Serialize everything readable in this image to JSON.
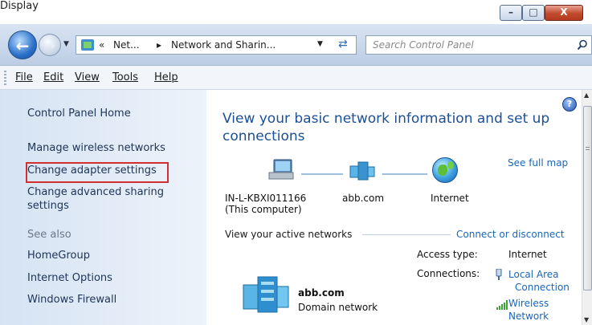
{
  "window": {
    "title": "Display",
    "minimize": "–",
    "maximize": "□",
    "close": "X"
  },
  "address": {
    "crumbs": [
      "«",
      "Net...",
      "▸",
      "Network and Sharin..."
    ],
    "search_placeholder": "Search Control Panel"
  },
  "menu": [
    "File",
    "Edit",
    "View",
    "Tools",
    "Help"
  ],
  "sidebar": {
    "home": "Control Panel Home",
    "links": [
      "Manage wireless networks",
      "Change adapter settings",
      "Change advanced sharing",
      "settings"
    ],
    "see_also_label": "See also",
    "see_also": [
      "HomeGroup",
      "Internet Options",
      "Windows Firewall"
    ]
  },
  "main": {
    "title_line1": "View your basic network information and set up",
    "title_line2": "connections",
    "see_full_map": "See full map",
    "nodes": {
      "computer_line1": "IN-L-KBXI011166",
      "computer_line2": "(This computer)",
      "domain": "abb.com",
      "internet": "Internet"
    },
    "active_networks_label": "View your active networks",
    "connect_disconnect": "Connect or disconnect",
    "network": {
      "name": "abb.com",
      "type": "Domain network",
      "access_type_label": "Access type:",
      "access_type_value": "Internet",
      "connections_label": "Connections:",
      "conn1_line1": "Local Area",
      "conn1_line2": "Connection",
      "conn2_line1": "Wireless",
      "conn2_line2": "Network"
    }
  },
  "colors": {
    "link": "#1a66b8",
    "title": "#1c4f96",
    "highlight": "#d32f2f",
    "sidebar": "#dce8f5"
  }
}
